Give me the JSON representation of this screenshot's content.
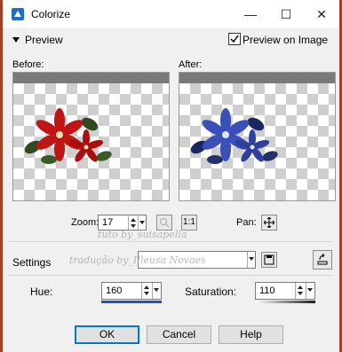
{
  "window": {
    "title": "Colorize",
    "minimize": "—",
    "maximize": "☐",
    "close": "✕"
  },
  "preview": {
    "toggle_label": "Preview",
    "checkbox_label": "Preview on Image",
    "checkbox_checked": true
  },
  "before": {
    "label": "Before:"
  },
  "after": {
    "label": "After:"
  },
  "zoom": {
    "label": "Zoom:",
    "value": "17"
  },
  "pan": {
    "label": "Pan:"
  },
  "settings": {
    "label": "Settings",
    "value": ""
  },
  "hue": {
    "label": "Hue:",
    "value": "160"
  },
  "saturation": {
    "label": "Saturation:",
    "value": "110"
  },
  "buttons": {
    "ok": "OK",
    "cancel": "Cancel",
    "help": "Help"
  },
  "watermark": {
    "line1": "tuto by_suisapella",
    "line2": "tradução by_Illeusa Novaes"
  },
  "colors": {
    "hue_bar": "#1f4fd8",
    "sat_bar": "#1a1a1a",
    "ok_border": "#0078d7"
  }
}
